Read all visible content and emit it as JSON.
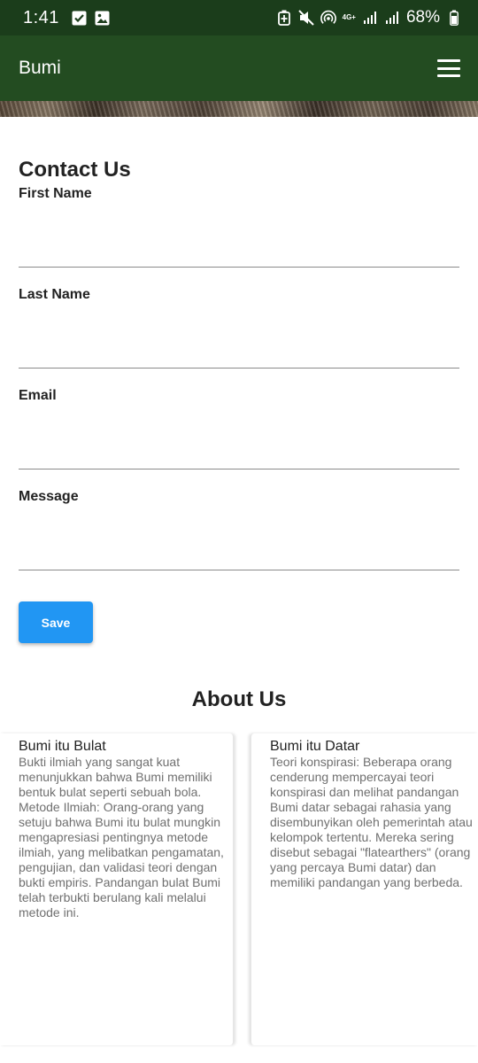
{
  "status_bar": {
    "time": "1:41",
    "battery": "68%",
    "network_label": "4G+",
    "left_icons": [
      "checkbox-notification-icon",
      "image-notification-icon"
    ],
    "right_icons": [
      "battery-saver-icon",
      "mute-icon",
      "hotspot-icon",
      "signal-icon",
      "signal-icon",
      "battery-icon"
    ]
  },
  "app_bar": {
    "title": "Bumi",
    "menu_icon": "hamburger-menu-icon",
    "color": "#234c21"
  },
  "contact": {
    "title": "Contact Us",
    "fields": [
      {
        "label": "First Name",
        "value": ""
      },
      {
        "label": "Last Name",
        "value": ""
      },
      {
        "label": "Email",
        "value": ""
      },
      {
        "label": "Message",
        "value": ""
      }
    ],
    "save_label": "Save",
    "save_color": "#2196f3"
  },
  "about": {
    "title": "About Us",
    "cards": [
      {
        "title": "Bumi itu Bulat",
        "body": "Bukti ilmiah yang sangat kuat menunjukkan bahwa Bumi memiliki bentuk bulat seperti sebuah bola. Metode Ilmiah: Orang-orang yang setuju bahwa Bumi itu bulat mungkin mengapresiasi pentingnya metode ilmiah, yang melibatkan pengamatan, pengujian, dan validasi teori dengan bukti empiris. Pandangan bulat Bumi telah terbukti berulang kali melalui metode ini."
      },
      {
        "title": "Bumi itu Datar",
        "body": "Teori konspirasi: Beberapa orang cenderung mempercayai teori konspirasi dan melihat pandangan Bumi datar sebagai rahasia yang disembunyikan oleh pemerintah atau kelompok tertentu. Mereka sering disebut sebagai \"flatearthers\" (orang yang percaya Bumi datar) dan memiliki pandangan yang berbeda."
      }
    ]
  }
}
